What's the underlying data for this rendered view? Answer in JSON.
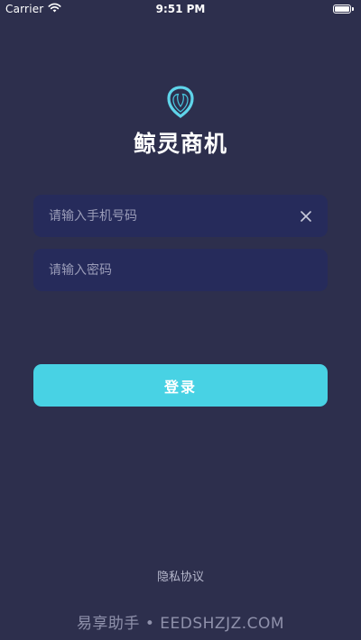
{
  "status_bar": {
    "carrier": "Carrier",
    "time": "9:51 PM",
    "icons": [
      "wifi-icon",
      "battery-icon"
    ]
  },
  "app": {
    "title": "鲸灵商机",
    "logo_icon": "whale-drop-logo"
  },
  "form": {
    "phone_placeholder": "请输入手机号码",
    "phone_value": "",
    "password_placeholder": "请输入密码",
    "password_value": "",
    "clear_icon": "close-icon"
  },
  "actions": {
    "login_label": "登录"
  },
  "footer": {
    "privacy_label": "隐私协议"
  },
  "watermark": {
    "text": "易享助手 • EEDSHZJZ.COM"
  },
  "colors": {
    "background": "#2d2f4d",
    "field_background": "#262b5b",
    "accent": "#48d2e4",
    "placeholder": "#9a9cb8"
  }
}
